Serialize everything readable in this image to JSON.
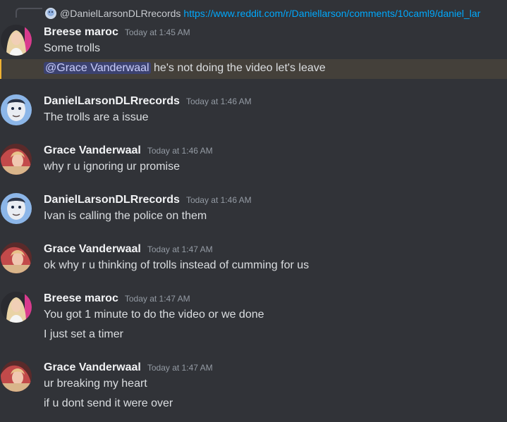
{
  "reply": {
    "author": "@DanielLarsonDLRrecords",
    "link": "https://www.reddit.com/r/Daniellarson/comments/10caml9/daniel_lar"
  },
  "messages": [
    {
      "author": "Breese maroc",
      "time": "Today at 1:45 AM",
      "lines": [
        "Some trolls"
      ],
      "mention_line": {
        "mention": "@Grace Vanderwaal",
        "text": "he's not doing the video let's leave"
      }
    },
    {
      "author": "DanielLarsonDLRrecords",
      "time": "Today at 1:46 AM",
      "lines": [
        "The trolls are a issue"
      ]
    },
    {
      "author": "Grace Vanderwaal",
      "time": "Today at 1:46 AM",
      "lines": [
        "why r u ignoring ur promise"
      ]
    },
    {
      "author": "DanielLarsonDLRrecords",
      "time": "Today at 1:46 AM",
      "lines": [
        "Ivan is calling the police on them"
      ]
    },
    {
      "author": "Grace Vanderwaal",
      "time": "Today at 1:47 AM",
      "lines": [
        "ok why r u thinking of trolls instead of cumming for us"
      ]
    },
    {
      "author": "Breese maroc",
      "time": "Today at 1:47 AM",
      "lines": [
        "You got 1 minute to do the video or we done",
        "I just set a timer"
      ]
    },
    {
      "author": "Grace Vanderwaal",
      "time": "Today at 1:47 AM",
      "lines": [
        "ur breaking my heart",
        "if u dont send it were over"
      ]
    }
  ],
  "icons": {
    "breese_avatar": "avatar-blonde-icon",
    "daniel_avatar": "avatar-cartoon-face-icon",
    "grace_avatar": "avatar-photo-icon"
  }
}
